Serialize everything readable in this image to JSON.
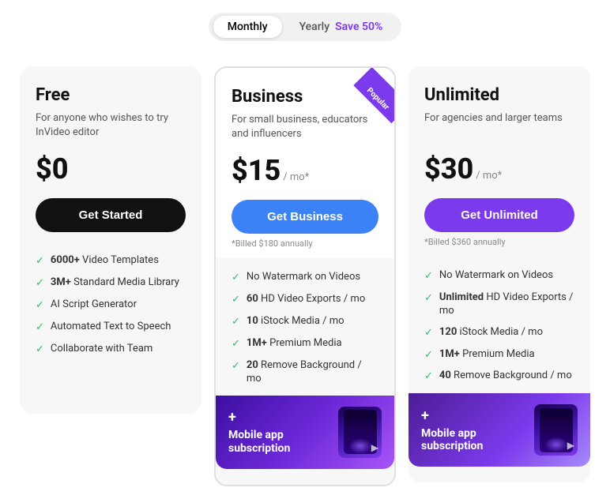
{
  "toggle": {
    "options": [
      {
        "label": "Monthly",
        "active": true
      },
      {
        "label": "Yearly",
        "active": false
      }
    ],
    "save_text": "Save 50%"
  },
  "plans": [
    {
      "id": "free",
      "name": "Free",
      "description": "For anyone who wishes to try InVideo editor",
      "price": "$0",
      "period": "",
      "button_label": "Get Started",
      "button_type": "dark",
      "billed_note": "",
      "popular": false,
      "features": [
        {
          "text": "6000+ Video Templates",
          "bold_prefix": "6000+"
        },
        {
          "text": "3M+ Standard Media Library",
          "bold_prefix": "3M+"
        },
        {
          "text": "AI Script Generator",
          "bold_prefix": ""
        },
        {
          "text": "Automated Text to Speech",
          "bold_prefix": ""
        },
        {
          "text": "Collaborate with Team",
          "bold_prefix": ""
        }
      ],
      "mobile_banner": false
    },
    {
      "id": "business",
      "name": "Business",
      "description": "For small business, educators and influencers",
      "price": "$15",
      "period": "/ mo*",
      "button_label": "Get Business",
      "button_type": "blue",
      "billed_note": "*Billed $180 annually",
      "popular": true,
      "popular_label": "Popular",
      "features": [
        {
          "text": "No Watermark on Videos",
          "bold_prefix": ""
        },
        {
          "text": "60 HD Video Exports / mo",
          "bold_prefix": "60"
        },
        {
          "text": "10 iStock Media / mo",
          "bold_prefix": "10"
        },
        {
          "text": "1M+ Premium Media",
          "bold_prefix": "1M+"
        },
        {
          "text": "20 Remove Background / mo",
          "bold_prefix": "20"
        }
      ],
      "mobile_banner": true,
      "banner_plus": "+",
      "banner_title": "Mobile app\nsubscription",
      "banner_color": "blue"
    },
    {
      "id": "unlimited",
      "name": "Unlimited",
      "description": "For agencies and larger teams",
      "price": "$30",
      "period": "/ mo*",
      "button_label": "Get Unlimited",
      "button_type": "purple",
      "billed_note": "*Billed $360 annually",
      "popular": false,
      "features": [
        {
          "text": "No Watermark on Videos",
          "bold_prefix": ""
        },
        {
          "text": "Unlimited HD Video Exports / mo",
          "bold_prefix": "Unlimited"
        },
        {
          "text": "120 iStock Media / mo",
          "bold_prefix": "120"
        },
        {
          "text": "1M+ Premium Media",
          "bold_prefix": "1M+"
        },
        {
          "text": "40 Remove Background / mo",
          "bold_prefix": "40"
        }
      ],
      "mobile_banner": true,
      "banner_plus": "+",
      "banner_title": "Mobile app\nsubscription",
      "banner_color": "purple"
    }
  ]
}
